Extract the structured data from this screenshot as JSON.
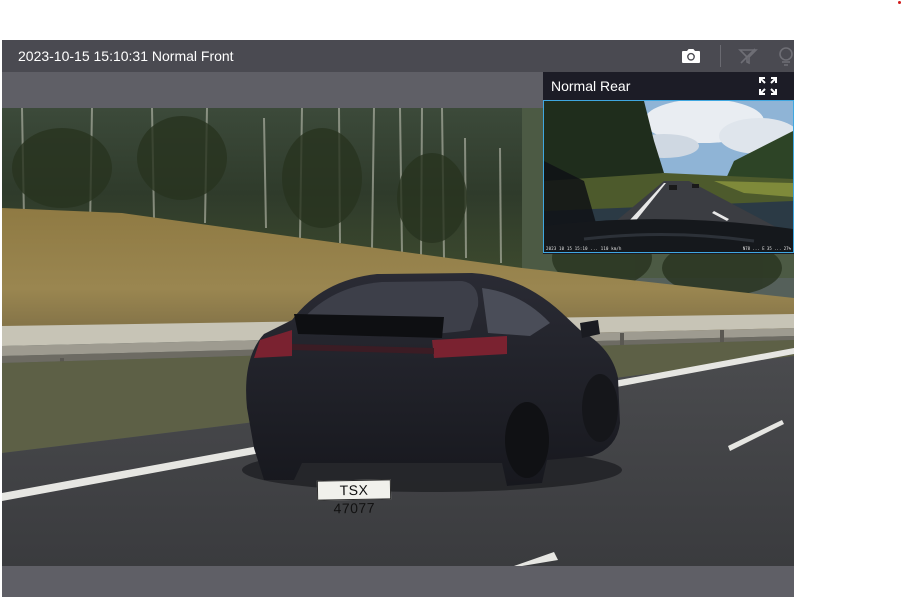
{
  "player": {
    "front_title": "2023-10-15 15:10:31 Normal Front",
    "rear_title": "Normal Rear",
    "rear_osd_left": "2023 10 15 15:10 ... 110 km/h",
    "rear_osd_right": "N78 ... E 35 ... 27%",
    "plate_text": "TSX 47077",
    "icons": {
      "snapshot": "camera-icon",
      "flip": "flip-icon",
      "hide": "eye-off-icon",
      "fullscreen": "fullscreen-icon"
    },
    "colors": {
      "topbar": "#4a4a51",
      "player_bg": "#5f5f66",
      "pip_border": "#3fa7e0"
    }
  }
}
